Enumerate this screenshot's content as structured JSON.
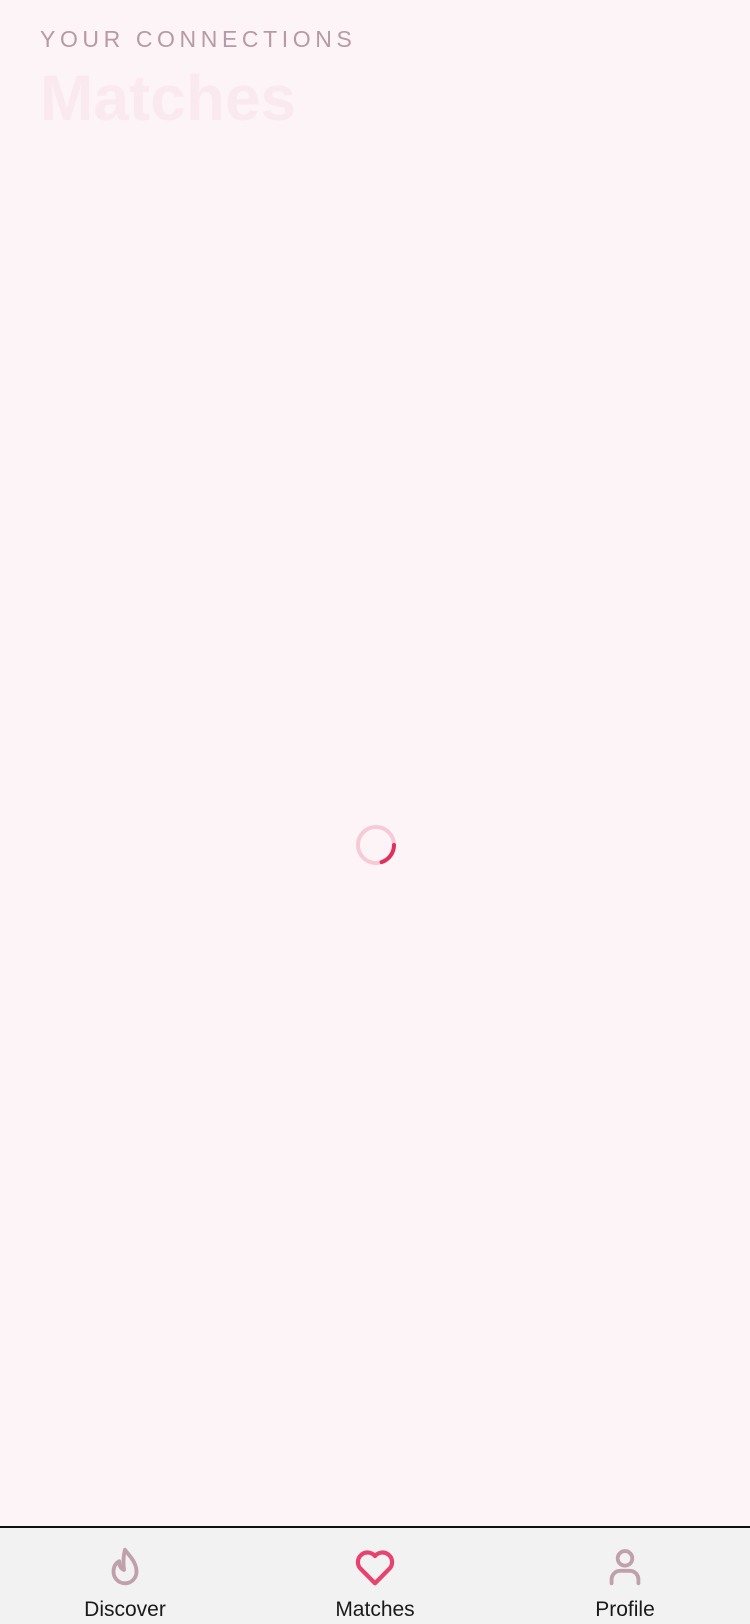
{
  "header": {
    "eyebrow": "YOUR CONNECTIONS",
    "title": "Matches"
  },
  "loading_indicator": {
    "icon": "spinner-icon",
    "track_color": "#f6cad7",
    "arc_color": "#e0315e"
  },
  "tabbar": {
    "active_color": "#e8436f",
    "inactive_color": "#c0a0ab",
    "items": [
      {
        "label": "Discover",
        "icon": "flame-icon",
        "active": false
      },
      {
        "label": "Matches",
        "icon": "heart-icon",
        "active": true
      },
      {
        "label": "Profile",
        "icon": "person-icon",
        "active": false
      }
    ]
  }
}
